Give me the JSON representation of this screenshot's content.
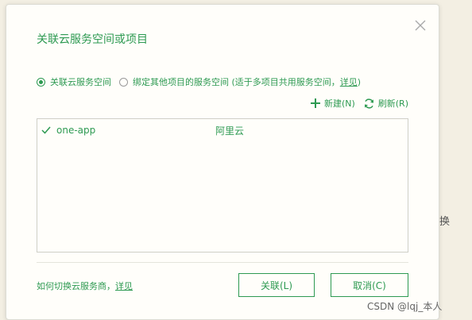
{
  "background": {
    "partial_text": "换",
    "watermark": "CSDN @lqj_本人"
  },
  "dialog": {
    "title": "关联云服务空间或项目",
    "radio_options": {
      "option1": "关联云服务空间",
      "option2_prefix": "绑定其他项目的服务空间 (适于多项目共用服务空间，",
      "option2_link": "详见",
      "option2_suffix": ")"
    },
    "toolbar": {
      "new_label": "新建(N)",
      "refresh_label": "刷新(R)"
    },
    "spaces": [
      {
        "name": "one-app",
        "provider": "阿里云",
        "selected": true
      }
    ],
    "footer": {
      "help_text": "如何切换云服务商，",
      "help_link": "详见"
    },
    "buttons": {
      "link_label": "关联(L)",
      "cancel_label": "取消(C)"
    }
  },
  "colors": {
    "accent": "#2e9a52",
    "dialog_bg": "#fffefa",
    "page_bg": "#f3efe3"
  }
}
